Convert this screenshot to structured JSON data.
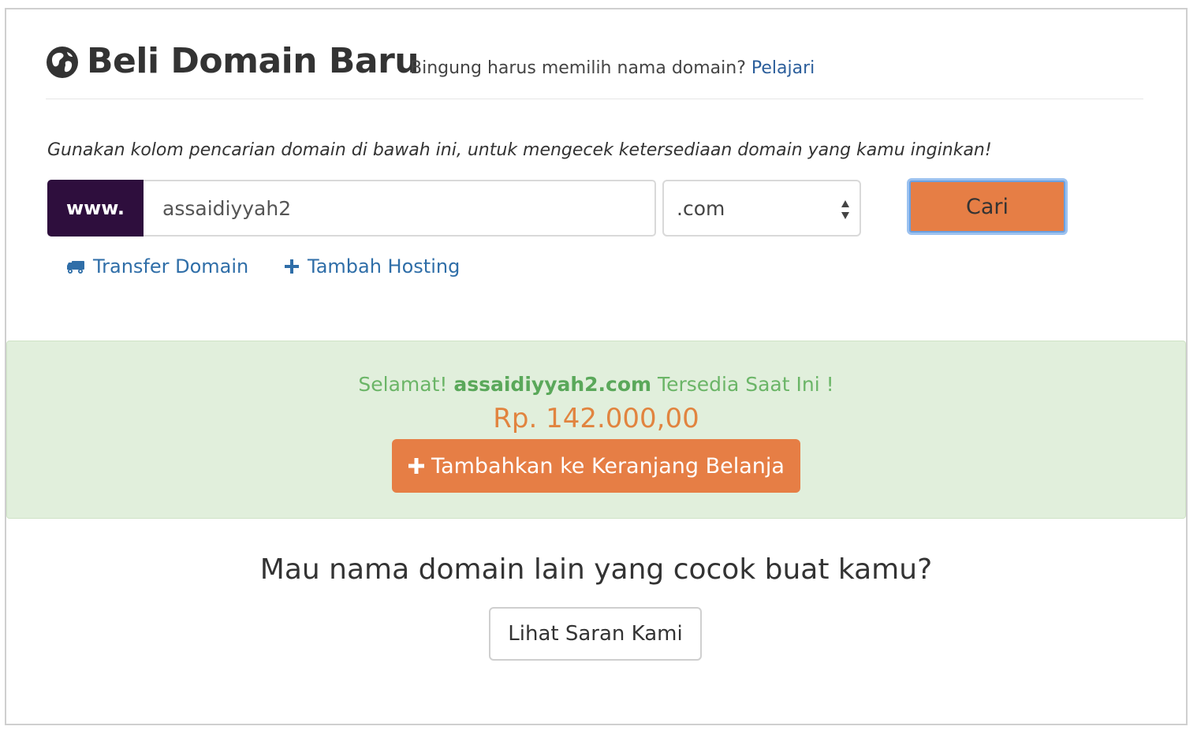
{
  "header": {
    "title": "Beli Domain Baru",
    "subtitle": "Bingung harus memilih nama domain?",
    "learn_link": "Pelajari",
    "icon": "globe-icon"
  },
  "search": {
    "instruction": "Gunakan kolom pencarian domain di bawah ini, untuk mengecek ketersediaan domain yang kamu inginkan!",
    "prefix": "www.",
    "domain_value": "assaidiyyah2",
    "tld_selected": ".com",
    "search_button": "Cari"
  },
  "links": {
    "transfer": "Transfer Domain",
    "transfer_icon": "truck-icon",
    "hosting": "Tambah Hosting",
    "hosting_icon": "plus-icon"
  },
  "result": {
    "prefix": "Selamat!",
    "domain": "assaidiyyah2.com",
    "suffix": "Tersedia Saat Ini !",
    "price": "Rp. 142.000,00",
    "add_to_cart": "Tambahkan ke Keranjang Belanja"
  },
  "suggestions": {
    "question": "Mau nama domain lain yang cocok buat kamu?",
    "button": "Lihat Saran Kami"
  },
  "colors": {
    "accent": "#e67e45",
    "prefix_bg": "#2e0e3d",
    "success_bg": "#e1efdc",
    "success_text": "#6bb567",
    "link": "#2f6ea8"
  }
}
